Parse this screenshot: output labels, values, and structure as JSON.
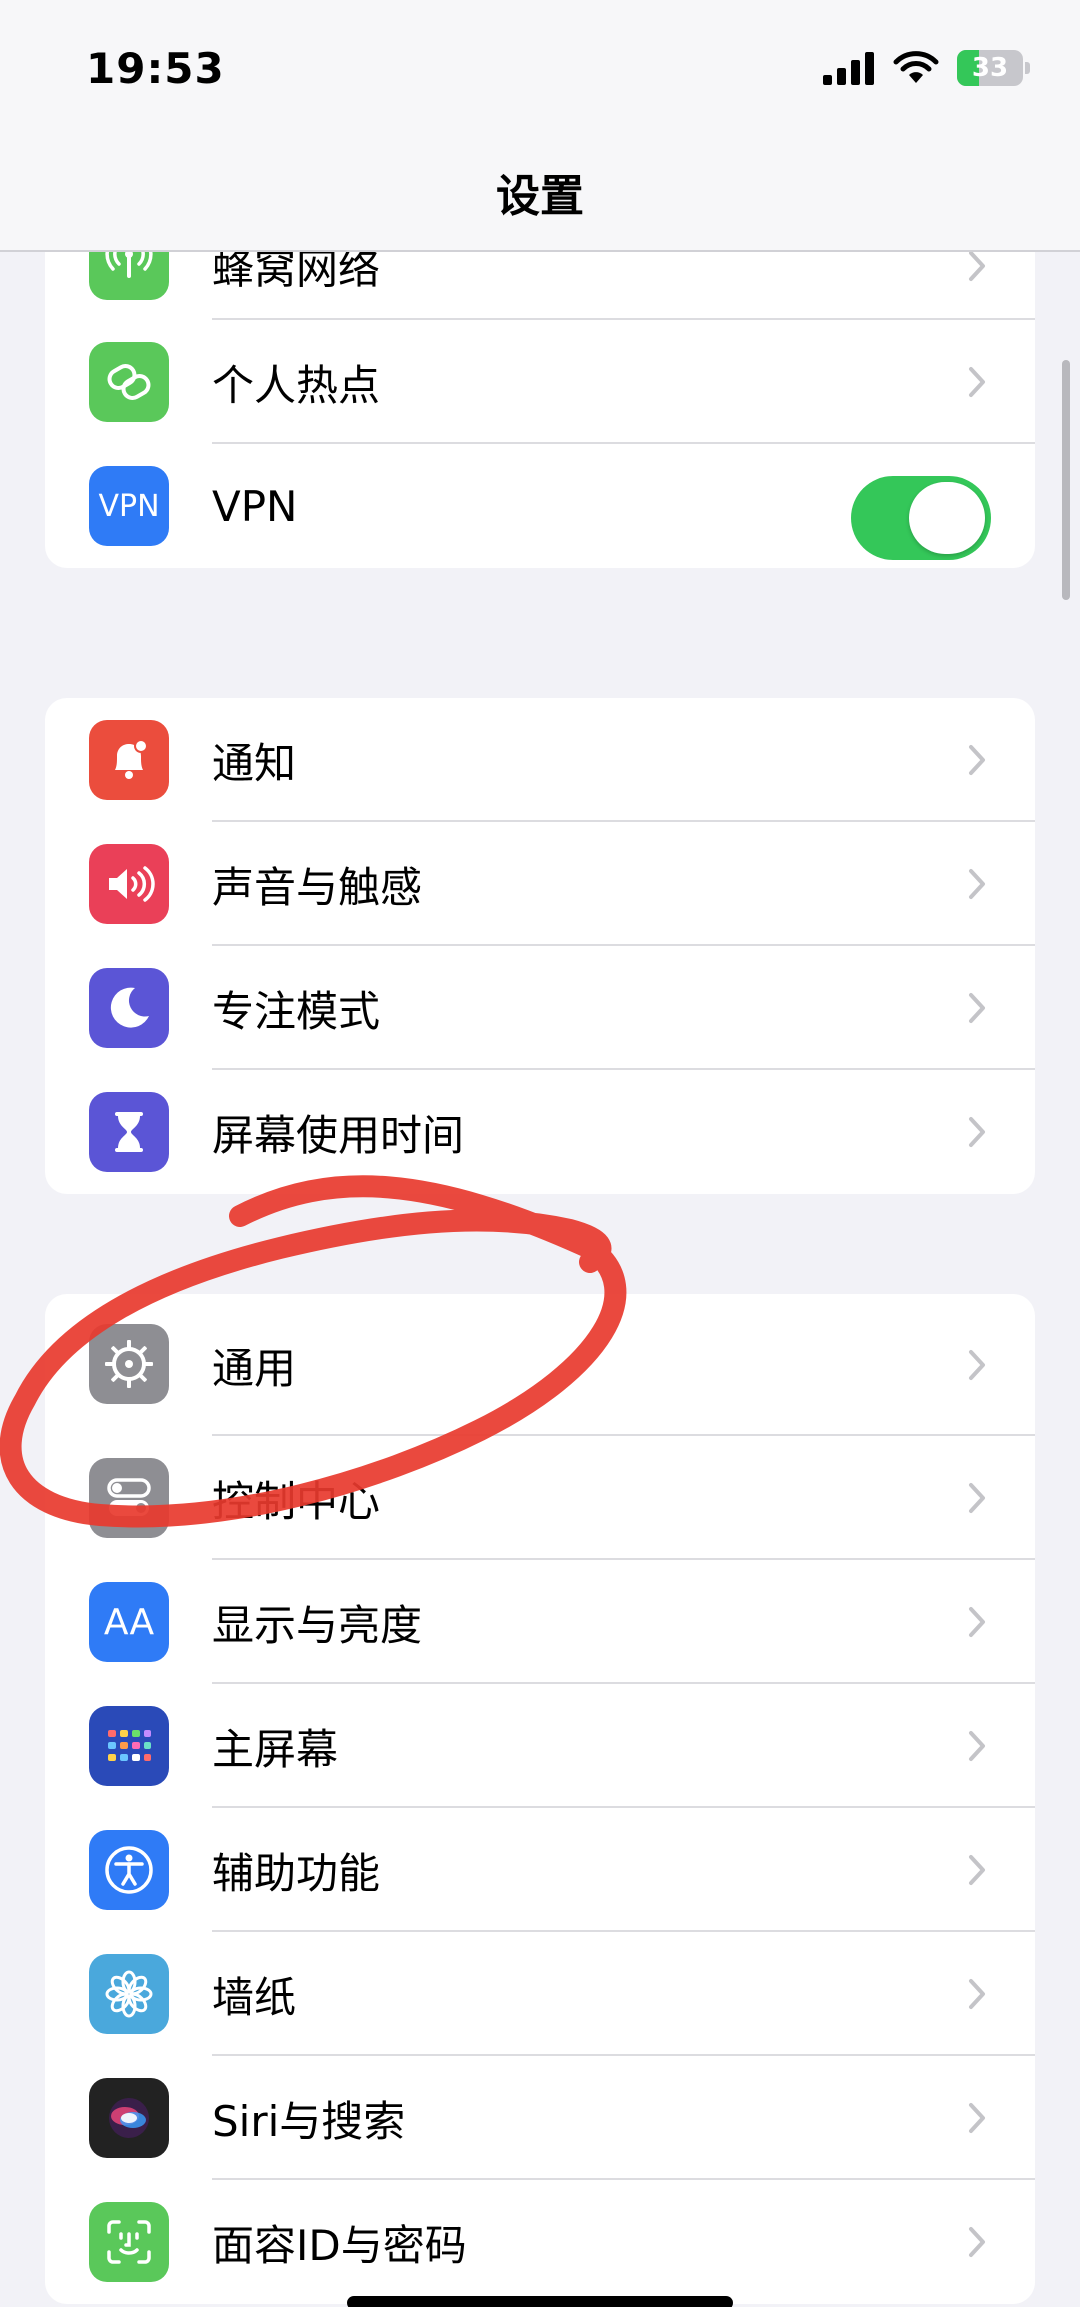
{
  "status_bar": {
    "time": "19:53",
    "battery_percent": "33",
    "battery_level": 0.33,
    "battery_color": "#34c759"
  },
  "header": {
    "title": "设置"
  },
  "groups": [
    {
      "name": "connectivity",
      "items": [
        {
          "label": "蜂窝网络",
          "icon": "cellular-antenna-icon",
          "icon_bg": "#5ac85a"
        },
        {
          "label": "个人热点",
          "icon": "hotspot-chain-icon",
          "icon_bg": "#5ac85a"
        },
        {
          "label": "VPN",
          "icon": "vpn-icon",
          "icon_text": "VPN",
          "icon_bg": "#2f7bf6",
          "toggle_on": true
        }
      ]
    },
    {
      "name": "notifications",
      "items": [
        {
          "label": "通知",
          "icon": "bell-icon",
          "icon_bg": "#eb4d3d"
        },
        {
          "label": "声音与触感",
          "icon": "speaker-icon",
          "icon_bg": "#ea4058"
        },
        {
          "label": "专注模式",
          "icon": "moon-icon",
          "icon_bg": "#5b55d6"
        },
        {
          "label": "屏幕使用时间",
          "icon": "hourglass-icon",
          "icon_bg": "#5b55d6"
        }
      ]
    },
    {
      "name": "general",
      "items": [
        {
          "label": "通用",
          "icon": "gear-icon",
          "icon_bg": "#8e8e93"
        },
        {
          "label": "控制中心",
          "icon": "control-toggles-icon",
          "icon_bg": "#8e8e93"
        },
        {
          "label": "显示与亮度",
          "icon": "text-size-icon",
          "icon_text": "AA",
          "icon_bg": "#2f7bf6"
        },
        {
          "label": "主屏幕",
          "icon": "home-screen-grid-icon",
          "icon_bg": "#2a4ab8"
        },
        {
          "label": "辅助功能",
          "icon": "accessibility-icon",
          "icon_bg": "#2f7bf6"
        },
        {
          "label": "墙纸",
          "icon": "flower-icon",
          "icon_bg": "#4aa8dc"
        },
        {
          "label": "Siri与搜索",
          "icon": "siri-icon",
          "icon_bg": "#222222"
        },
        {
          "label": "面容ID与密码",
          "icon": "face-id-icon",
          "icon_bg": "#5ac85a"
        }
      ]
    }
  ],
  "annotation": {
    "color": "#e8392e"
  }
}
